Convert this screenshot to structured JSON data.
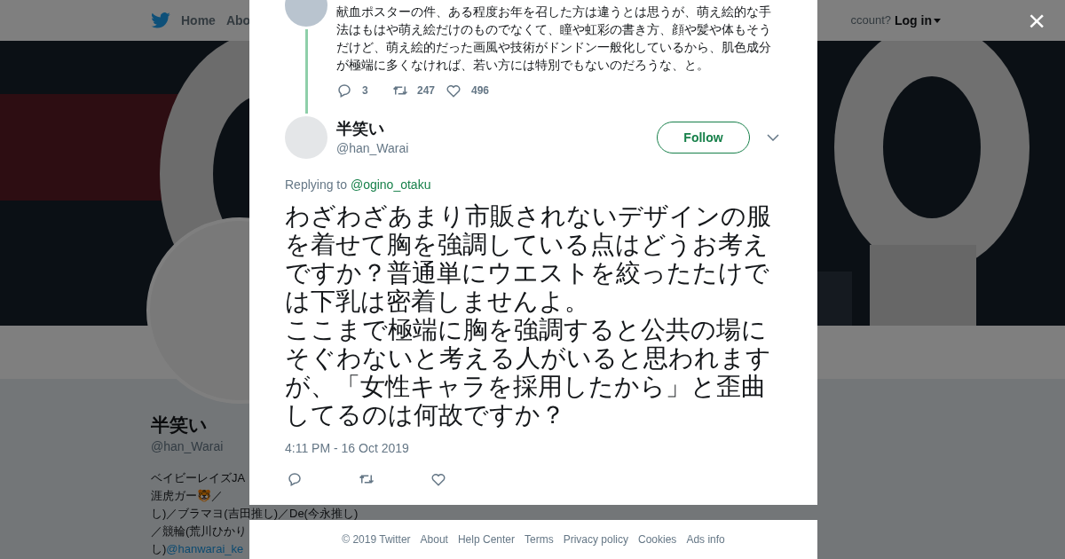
{
  "nav": {
    "items": [
      {
        "label": "Home",
        "selected": false
      },
      {
        "label": "Abo",
        "selected": false
      }
    ],
    "account_prompt": "ccount?",
    "login": "Log in"
  },
  "profile": {
    "name": "半笑い",
    "handle": "@han_Warai",
    "bio": [
      "ベイビーレイズJA",
      "涯虎ガー🐯／",
      "し)／ブラマヨ(吉田推し)／De(今永推し)",
      "／競輪(荒川ひかり"
    ],
    "bio_last": {
      "text": "し)",
      "link": "@hanwarai_ke"
    }
  },
  "modal": {
    "close": "×",
    "parent_tweet": {
      "text": "献血ポスターの件、ある程度お年を召した方は違うとは思うが、萌え絵的な手法はもはや萌え絵だけのものでなくて、瞳や虹彩の書き方、顔や髪や体もそうだけど、萌え絵的だった画風や技術がドンドン一般化しているから、肌色成分が極端に多くなければ、若い方には特別でもないのだろうな、と。",
      "replies": "3",
      "retweets": "247",
      "likes": "496"
    },
    "tweet": {
      "name": "半笑い",
      "handle": "@han_Warai",
      "follow": "Follow",
      "replying_label": "Replying to",
      "replying_to": "@ogino_otaku",
      "paragraphs": [
        "わざわざあまり市販されないデザインの服を着せて胸を強調している点はどうお考えですか？普通単にウエストを絞ったたけでは下乳は密着しませんよ。",
        "ここまで極端に胸を強調すると公共の場にそぐわないと考える人がいると思われます",
        "が、「女性キャラを採用したから」と歪曲してるのは何故ですか？"
      ],
      "time": "4:11 PM - 16 Oct 2019"
    }
  },
  "footer": [
    "© 2019 Twitter",
    "About",
    "Help Center",
    "Terms",
    "Privacy policy",
    "Cookies",
    "Ads info"
  ]
}
